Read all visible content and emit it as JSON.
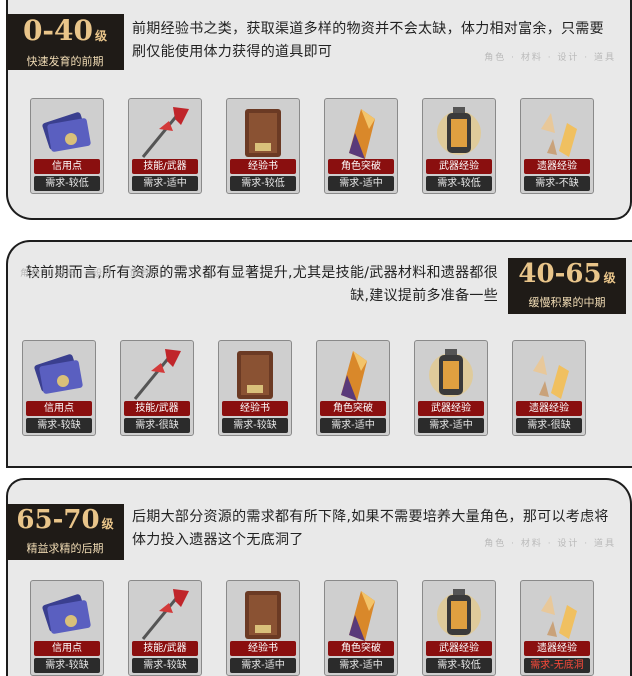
{
  "sections": [
    {
      "level": "0-40",
      "level_unit": "级",
      "subtitle": "快速发育的前期",
      "description": "前期经验书之类，获取渠道多样的物资并不会太缺，体力相对富余，只需要刷仅能使用体力获得的道具即可",
      "tags": "角色 · 材料 · 设计 · 道具",
      "items": [
        {
          "name": "信用点",
          "req": "需求-较低",
          "icon": "credit-card-icon"
        },
        {
          "name": "技能/武器",
          "req": "需求-适中",
          "icon": "spear-icon"
        },
        {
          "name": "经验书",
          "req": "需求-较低",
          "icon": "book-icon"
        },
        {
          "name": "角色突破",
          "req": "需求-适中",
          "icon": "crystal-icon"
        },
        {
          "name": "武器经验",
          "req": "需求-较低",
          "icon": "battery-icon"
        },
        {
          "name": "遗器经验",
          "req": "需求-不缺",
          "icon": "shard-icon"
        }
      ]
    },
    {
      "level": "40-65",
      "level_unit": "级",
      "subtitle": "缓慢积累的中期",
      "description": "较前期而言,所有资源的需求都有显著提升,尤其是技能/武器材料和遗器都很缺,建议提前多准备一些",
      "tags": "角色 · 材料 · 设计 · 道具",
      "items": [
        {
          "name": "信用点",
          "req": "需求-较缺",
          "icon": "credit-card-icon"
        },
        {
          "name": "技能/武器",
          "req": "需求-很缺",
          "icon": "spear-icon"
        },
        {
          "name": "经验书",
          "req": "需求-较缺",
          "icon": "book-icon"
        },
        {
          "name": "角色突破",
          "req": "需求-适中",
          "icon": "crystal-icon"
        },
        {
          "name": "武器经验",
          "req": "需求-适中",
          "icon": "battery-icon"
        },
        {
          "name": "遗器经验",
          "req": "需求-很缺",
          "icon": "shard-icon"
        }
      ]
    },
    {
      "level": "65-70",
      "level_unit": "级",
      "subtitle": "精益求精的后期",
      "description": "后期大部分资源的需求都有所下降,如果不需要培养大量角色，那可以考虑将体力投入遗器这个无底洞了",
      "tags": "角色 · 材料 · 设计 · 道具",
      "items": [
        {
          "name": "信用点",
          "req": "需求-较缺",
          "icon": "credit-card-icon"
        },
        {
          "name": "技能/武器",
          "req": "需求-较缺",
          "icon": "spear-icon"
        },
        {
          "name": "经验书",
          "req": "需求-适中",
          "icon": "book-icon"
        },
        {
          "name": "角色突破",
          "req": "需求-适中",
          "icon": "crystal-icon"
        },
        {
          "name": "武器经验",
          "req": "需求-较低",
          "icon": "battery-icon"
        },
        {
          "name": "遗器经验",
          "req": "需求-无底洞",
          "icon": "shard-icon",
          "highlight": true
        }
      ]
    }
  ],
  "colors": {
    "panel": "#e9e9e9",
    "badge": "#1f1b17",
    "badge_text": "#e9c58a",
    "name_bar": "#8a0f0f",
    "req_bar": "#2b2b2b",
    "highlight": "#ff4a3a"
  }
}
